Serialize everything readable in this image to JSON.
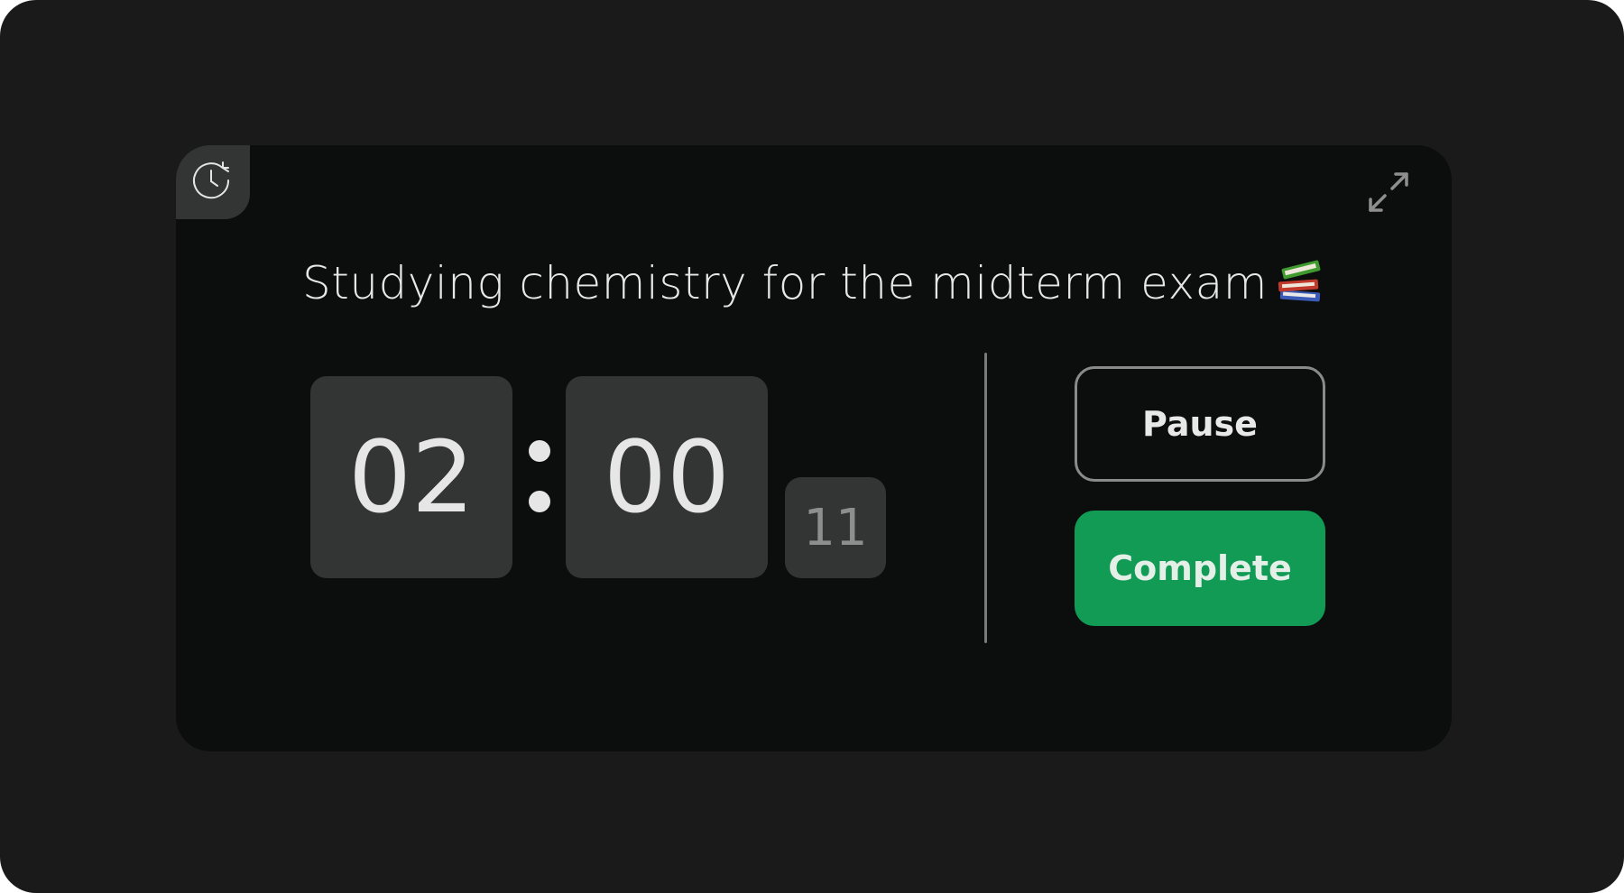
{
  "task": {
    "title": "Studying chemistry for the midterm exam",
    "emoji": "books-emoji"
  },
  "timer": {
    "hours": "02",
    "minutes": "00",
    "seconds": "11",
    "separator": ":"
  },
  "actions": {
    "pause_label": "Pause",
    "complete_label": "Complete"
  },
  "icons": {
    "history": "history-clock-icon",
    "expand": "expand-icon"
  },
  "colors": {
    "background": "#1a1a1a",
    "card": "#0c0e0d",
    "tile": "#333534",
    "accent_green": "#119b55",
    "text": "#e6e6e6"
  }
}
